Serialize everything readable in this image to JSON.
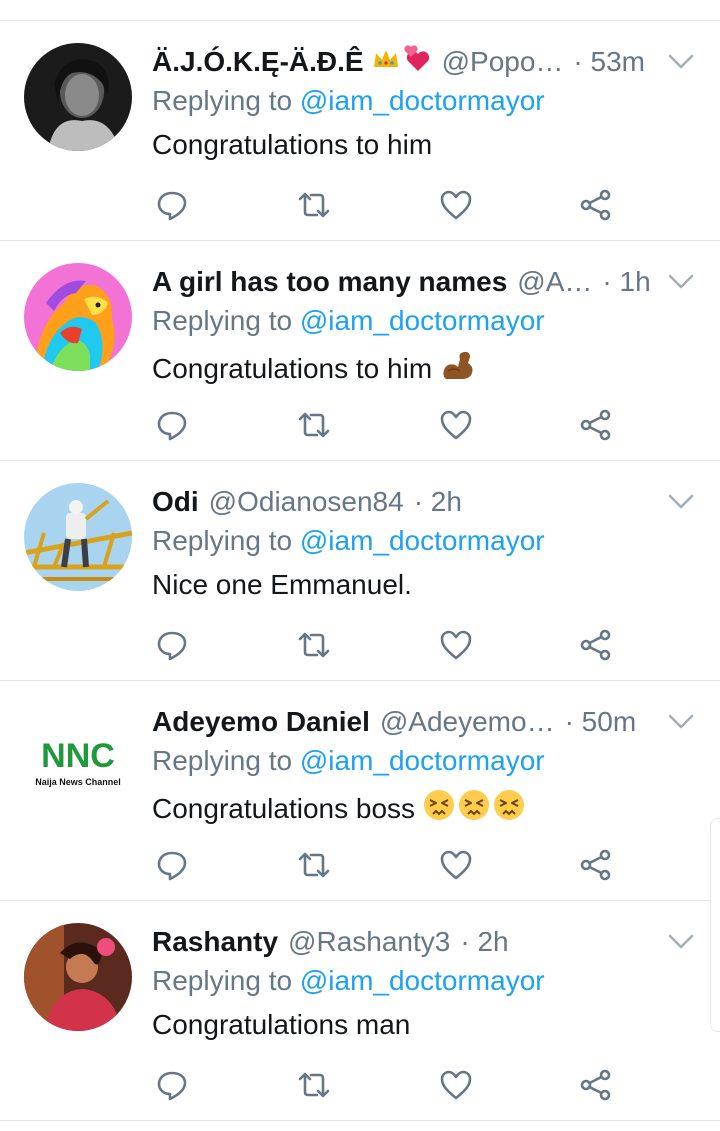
{
  "colors": {
    "name": "#14171a",
    "secondary": "#657786",
    "link": "#1da1f2",
    "divider": "#e1e8ed"
  },
  "replying_prefix": "Replying to",
  "tweets": [
    {
      "name": "Ä.J.Ó.K.Ę-Ä.Đ.Ê",
      "name_emojis": [
        "crown-emoji",
        "revolving-hearts-emoji"
      ],
      "handle": "@Popo…",
      "time": "· 53m",
      "mention": "@iam_doctormayor",
      "text": "Congratulations to him",
      "text_emojis": [],
      "avatar": "woman-portrait-bw"
    },
    {
      "name": "A girl has too many names",
      "name_emojis": [],
      "handle": "@A…",
      "time": "· 1h",
      "mention": "@iam_doctormayor",
      "text": "Congratulations to him",
      "text_emojis": [
        "flexed-biceps-emoji"
      ],
      "avatar": "rainbow-lion"
    },
    {
      "name": "Odi",
      "name_emojis": [],
      "handle": "@Odianosen84",
      "time": "· 2h",
      "mention": "@iam_doctormayor",
      "text": "Nice one Emmanuel.",
      "text_emojis": [],
      "avatar": "worker-on-scaffold"
    },
    {
      "name": "Adeyemo Daniel",
      "name_emojis": [],
      "handle": "@Adeyemo…",
      "time": "· 50m",
      "mention": "@iam_doctormayor",
      "text": "Congratulations boss",
      "text_emojis": [
        "persevering-face-emoji",
        "persevering-face-emoji",
        "persevering-face-emoji"
      ],
      "avatar": "nnc-logo",
      "avatar_logo_text": "NNC",
      "avatar_logo_caption": "Naija News Channel"
    },
    {
      "name": "Rashanty",
      "name_emojis": [],
      "handle": "@Rashanty3",
      "time": "· 2h",
      "mention": "@iam_doctormayor",
      "text": "Congratulations man",
      "text_emojis": [],
      "avatar": "woman-portrait-color"
    }
  ]
}
